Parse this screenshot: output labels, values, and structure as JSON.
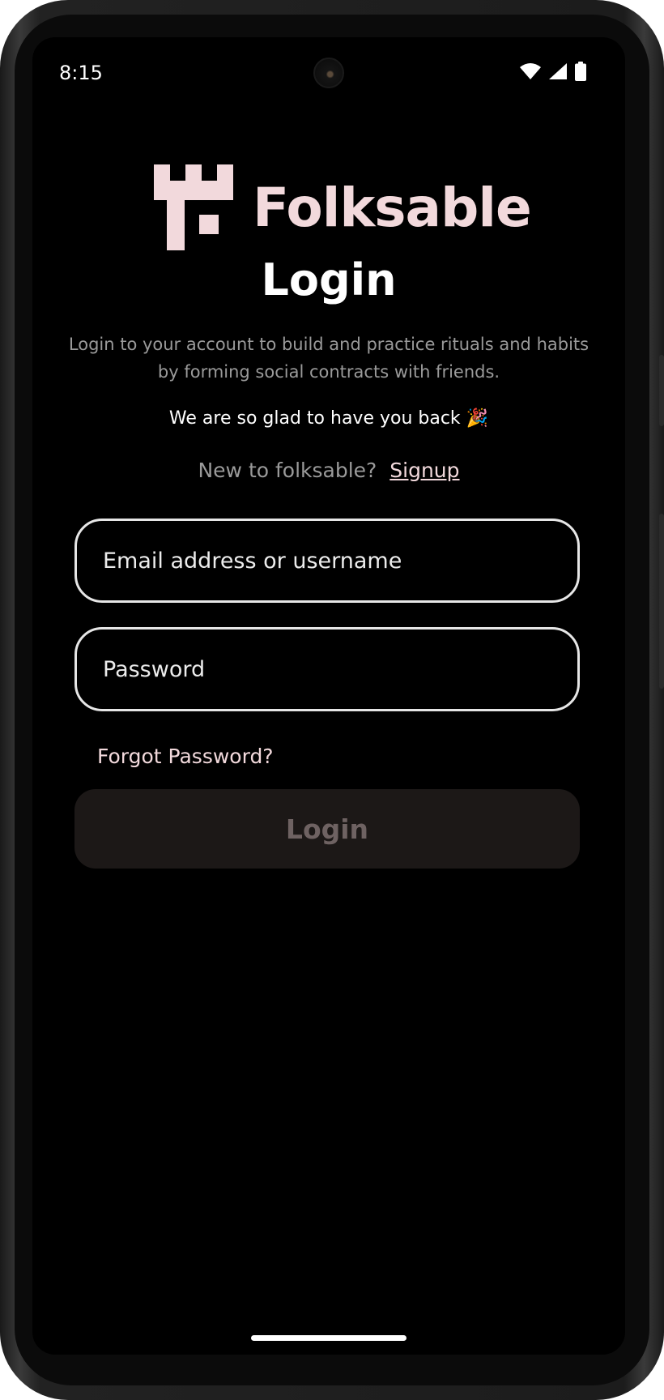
{
  "status_bar": {
    "time": "8:15",
    "icons": [
      "wifi-icon",
      "signal-icon",
      "battery-icon"
    ]
  },
  "brand": {
    "name": "Folksable",
    "logo_color": "#f2d9dc"
  },
  "login": {
    "title": "Login",
    "description": "Login to your account to build and practice rituals and habits by forming social contracts with friends.",
    "welcome": "We are so glad to have you back 🎉",
    "signup_prompt": "New to folksable?",
    "signup_link": "Signup",
    "email_placeholder": "Email address or username",
    "password_placeholder": "Password",
    "forgot_password": "Forgot Password?",
    "login_button": "Login"
  },
  "colors": {
    "background": "#000000",
    "accent": "#f2d9dc",
    "muted_text": "#9a9a9a",
    "button_disabled_bg": "#1c1817"
  }
}
